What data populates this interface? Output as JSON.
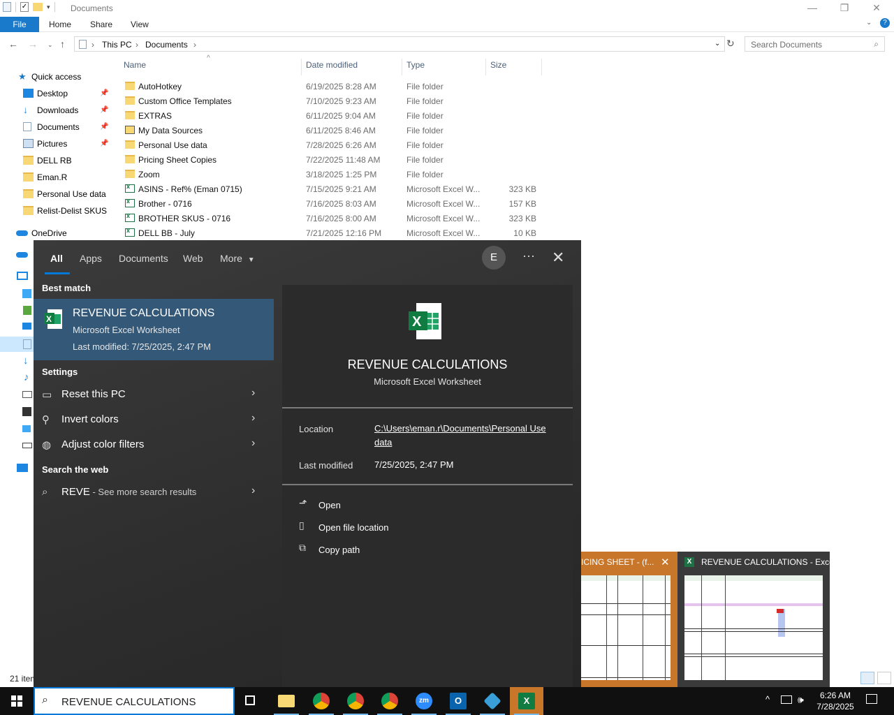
{
  "explorer": {
    "window_title": "Documents",
    "ribbon_tabs": [
      "File",
      "Home",
      "Share",
      "View"
    ],
    "breadcrumb": [
      "This PC",
      "Documents"
    ],
    "search_placeholder": "Search Documents",
    "nav": {
      "quick_access": "Quick access",
      "items": [
        {
          "label": "Desktop",
          "pinned": true,
          "icon": "desktop-icon"
        },
        {
          "label": "Downloads",
          "pinned": true,
          "icon": "downloads-icon"
        },
        {
          "label": "Documents",
          "pinned": true,
          "icon": "documents-icon"
        },
        {
          "label": "Pictures",
          "pinned": true,
          "icon": "pictures-icon"
        },
        {
          "label": "DELL RB",
          "pinned": false,
          "icon": "folder-icon"
        },
        {
          "label": "Eman.R",
          "pinned": false,
          "icon": "folder-icon"
        },
        {
          "label": "Personal Use data",
          "pinned": false,
          "icon": "folder-icon"
        },
        {
          "label": "Relist-Delist SKUS",
          "pinned": false,
          "icon": "folder-icon"
        }
      ],
      "onedrive": "OneDrive"
    },
    "columns": [
      "Name",
      "Date modified",
      "Type",
      "Size"
    ],
    "files": [
      {
        "name": "AutoHotkey",
        "date": "6/19/2025 8:28 AM",
        "type": "File folder",
        "size": "",
        "kind": "folder"
      },
      {
        "name": "Custom Office Templates",
        "date": "7/10/2025 9:23 AM",
        "type": "File folder",
        "size": "",
        "kind": "folder"
      },
      {
        "name": "EXTRAS",
        "date": "6/11/2025 9:04 AM",
        "type": "File folder",
        "size": "",
        "kind": "folder"
      },
      {
        "name": "My Data Sources",
        "date": "6/11/2025 8:46 AM",
        "type": "File folder",
        "size": "",
        "kind": "special-folder"
      },
      {
        "name": "Personal Use data",
        "date": "7/28/2025 6:26 AM",
        "type": "File folder",
        "size": "",
        "kind": "folder"
      },
      {
        "name": "Pricing Sheet Copies",
        "date": "7/22/2025 11:48 AM",
        "type": "File folder",
        "size": "",
        "kind": "folder"
      },
      {
        "name": "Zoom",
        "date": "3/18/2025 1:25 PM",
        "type": "File folder",
        "size": "",
        "kind": "folder"
      },
      {
        "name": "ASINS - Ref% (Eman 0715)",
        "date": "7/15/2025 9:21 AM",
        "type": "Microsoft Excel W...",
        "size": "323 KB",
        "kind": "excel"
      },
      {
        "name": "Brother - 0716",
        "date": "7/16/2025 8:03 AM",
        "type": "Microsoft Excel W...",
        "size": "157 KB",
        "kind": "excel"
      },
      {
        "name": "BROTHER SKUS - 0716",
        "date": "7/16/2025 8:00 AM",
        "type": "Microsoft Excel W...",
        "size": "323 KB",
        "kind": "excel"
      },
      {
        "name": "DELL BB - July",
        "date": "7/21/2025 12:16 PM",
        "type": "Microsoft Excel W...",
        "size": "10 KB",
        "kind": "excel"
      }
    ],
    "status_count": "21 item"
  },
  "search_panel": {
    "tabs": [
      "All",
      "Apps",
      "Documents",
      "Web",
      "More"
    ],
    "avatar_initial": "E",
    "best_match_heading": "Best match",
    "best_match": {
      "title": "REVENUE CALCULATIONS",
      "subtitle": "Microsoft Excel Worksheet",
      "modified": "Last modified: 7/25/2025, 2:47 PM"
    },
    "settings_heading": "Settings",
    "settings": [
      {
        "label": "Reset this PC",
        "icon": "laptop-icon"
      },
      {
        "label": "Invert colors",
        "icon": "magnifier-icon"
      },
      {
        "label": "Adjust color filters",
        "icon": "palette-icon"
      }
    ],
    "web_heading": "Search the web",
    "web_query": "REVE",
    "web_suffix": " - See more search results",
    "detail": {
      "title": "REVENUE CALCULATIONS",
      "subtitle": "Microsoft Excel Worksheet",
      "location_label": "Location",
      "location_value": "C:\\Users\\eman.r\\Documents\\Personal Use data",
      "modified_label": "Last modified",
      "modified_value": "7/25/2025, 2:47 PM",
      "actions": [
        "Open",
        "Open file location",
        "Copy path"
      ]
    }
  },
  "thumbnails": [
    {
      "title": "ICING SHEET - (f...",
      "color": "#c8762a"
    },
    {
      "title": "REVENUE CALCULATIONS - Excel",
      "color": "#3a3a3a"
    }
  ],
  "taskbar": {
    "search_text": "REVENUE CALCULATIONS",
    "time": "6:26 AM",
    "date": "7/28/2025"
  },
  "colors": {
    "accent": "#0078d7",
    "excel_green": "#1e7145",
    "selection": "#335878"
  }
}
